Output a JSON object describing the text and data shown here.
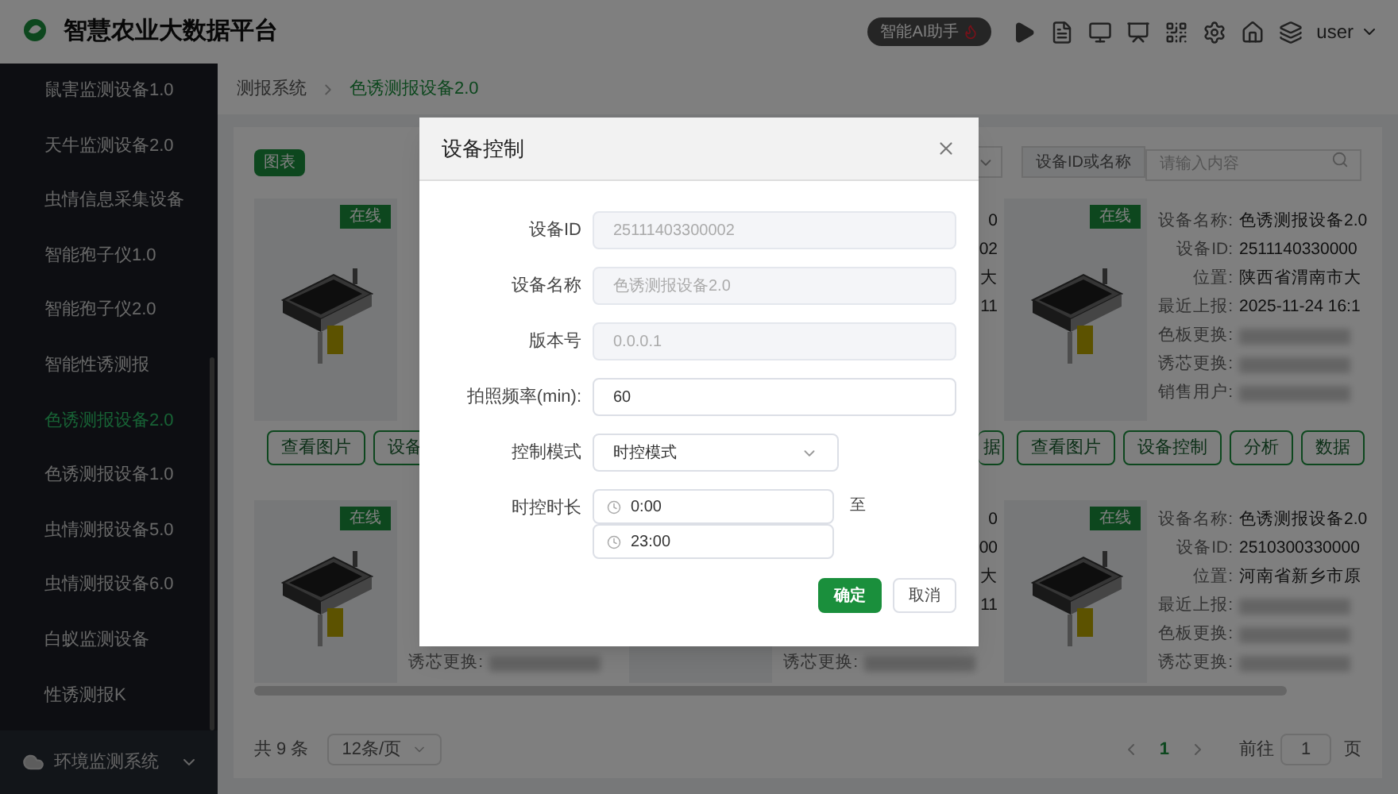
{
  "header": {
    "title": "智慧农业大数据平台",
    "ai_button": "智能AI助手",
    "user": "user"
  },
  "sidebar": {
    "items": [
      {
        "label": "鼠害监测设备1.0",
        "selected": false
      },
      {
        "label": "天牛监测设备2.0",
        "selected": false
      },
      {
        "label": "虫情信息采集设备",
        "selected": false
      },
      {
        "label": "智能孢子仪1.0",
        "selected": false
      },
      {
        "label": "智能孢子仪2.0",
        "selected": false
      },
      {
        "label": "智能性诱测报",
        "selected": false
      },
      {
        "label": "色诱测报设备2.0",
        "selected": true
      },
      {
        "label": "色诱测报设备1.0",
        "selected": false
      },
      {
        "label": "虫情测报设备5.0",
        "selected": false
      },
      {
        "label": "虫情测报设备6.0",
        "selected": false
      },
      {
        "label": "白蚁监测设备",
        "selected": false
      },
      {
        "label": "性诱测报K",
        "selected": false
      }
    ],
    "footer": {
      "label": "环境监测系统"
    }
  },
  "breadcrumb": [
    "测报系统",
    "色诱测报设备2.0"
  ],
  "toolbar": {
    "chart_button": "图表",
    "search_type": "设备ID或名称",
    "search": {
      "placeholder": "请输入内容"
    }
  },
  "card_rows": [
    {
      "cards": [
        {
          "badge": "在线",
          "rows": [
            {},
            {},
            {},
            {},
            {},
            {},
            {}
          ],
          "buttons": [
            "查看图片",
            "设备"
          ]
        },
        {
          "rows": [
            {
              "value": "0"
            },
            {
              "value": "02"
            },
            {
              "value": "大"
            },
            {
              "value": "11"
            },
            {},
            {},
            {}
          ],
          "buttons": [
            "据"
          ]
        },
        {
          "badge": "在线",
          "rows": [
            {
              "label": "设备名称:",
              "value": "色诱测报设备2.0"
            },
            {
              "label": "设备ID:",
              "value": "2511140330000"
            },
            {
              "label": "位置:",
              "value": "陕西省渭南市大"
            },
            {
              "label": "最近上报:",
              "value": "2025-11-24 16:1"
            },
            {
              "label": "色板更换:",
              "blurred": true
            },
            {
              "label": "诱芯更换:",
              "blurred": true
            },
            {
              "label": "销售用户:",
              "blurred": true
            }
          ],
          "buttons": [
            "查看图片",
            "设备控制",
            "分析",
            "数据"
          ]
        }
      ]
    },
    {
      "cards": [
        {
          "badge": "在线",
          "rows": [
            {},
            {},
            {},
            {},
            {},
            {
              "label": "诱芯更换:",
              "blurred": true
            }
          ]
        },
        {
          "rows": [
            {
              "value": "0"
            },
            {
              "value": "00"
            },
            {
              "value": "大"
            },
            {
              "value": "11"
            },
            {},
            {
              "label": "诱芯更换:",
              "blurred": true
            }
          ]
        },
        {
          "badge": "在线",
          "rows": [
            {
              "label": "设备名称:",
              "value": "色诱测报设备2.0"
            },
            {
              "label": "设备ID:",
              "value": "2510300330000"
            },
            {
              "label": "位置:",
              "value": "河南省新乡市原"
            },
            {
              "label": "最近上报:",
              "blurred": true
            },
            {
              "label": "色板更换:",
              "blurred": true
            },
            {
              "label": "诱芯更换:",
              "blurred": true
            }
          ]
        }
      ]
    }
  ],
  "pagination": {
    "total": "共 9 条",
    "page_size": "12条/页",
    "pages": [
      {
        "label": "1",
        "selected": true
      }
    ],
    "goto_label": "前往",
    "goto_value": "1",
    "goto_unit": "页"
  },
  "dialog": {
    "title": "设备控制",
    "fields": [
      {
        "kind": "input",
        "label": "设备ID",
        "value": "25111403300002",
        "disabled": true
      },
      {
        "kind": "input",
        "label": "设备名称",
        "value": "色诱测报设备2.0",
        "disabled": true
      },
      {
        "kind": "input",
        "label": "版本号",
        "value": "0.0.0.1",
        "disabled": true
      },
      {
        "kind": "input",
        "label": "拍照频率(min):",
        "value": "60",
        "disabled": false
      },
      {
        "kind": "select",
        "label": "控制模式",
        "value": "时控模式"
      },
      {
        "kind": "time_range",
        "label": "时控时长",
        "start": "0:00",
        "end": "23:00",
        "separator": "至"
      }
    ],
    "buttons": [
      {
        "label": "确定",
        "kind": "primary"
      },
      {
        "label": "取消",
        "kind": "default"
      }
    ]
  }
}
